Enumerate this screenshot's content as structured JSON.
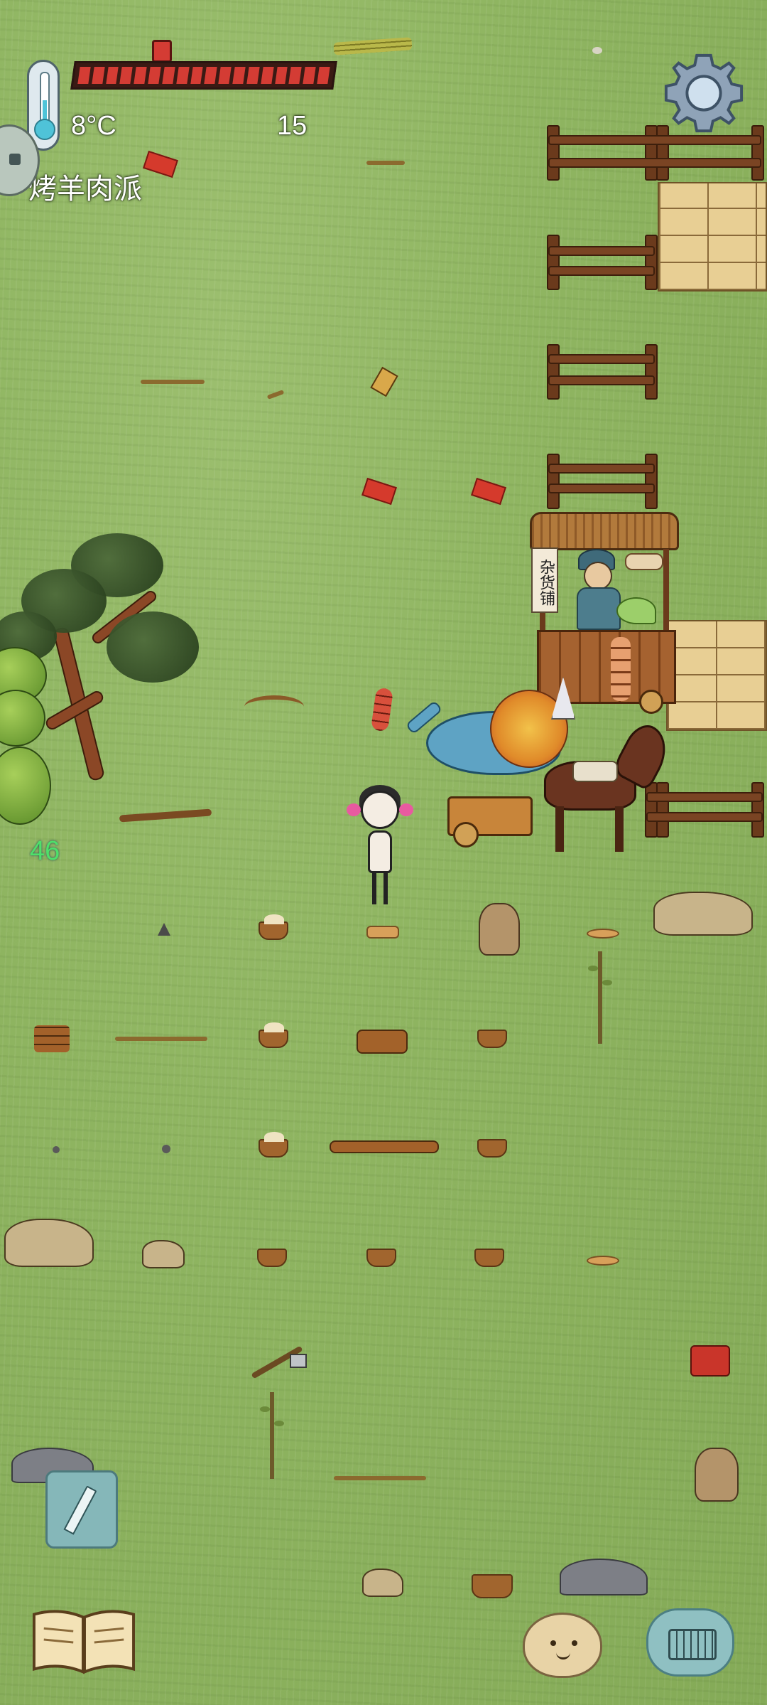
{
  "hud": {
    "temperature": "8°C",
    "count": "15",
    "recipe": "烤羊肉派",
    "health_segments": 18,
    "health_fraction": 1.0
  },
  "world": {
    "floating_number": "46",
    "stall_sign": "杂货铺"
  },
  "icons": {
    "thermometer": "thermometer-icon",
    "gear": "gear-icon",
    "pencil": "pencil-icon",
    "book": "book-icon",
    "potato": "potato-face-icon",
    "keyboard": "keyboard-icon"
  },
  "colors": {
    "grass": "#8fb561",
    "health": "#d43c34",
    "floating_number": "#4ee06a",
    "button_teal": "#85b7b9"
  }
}
